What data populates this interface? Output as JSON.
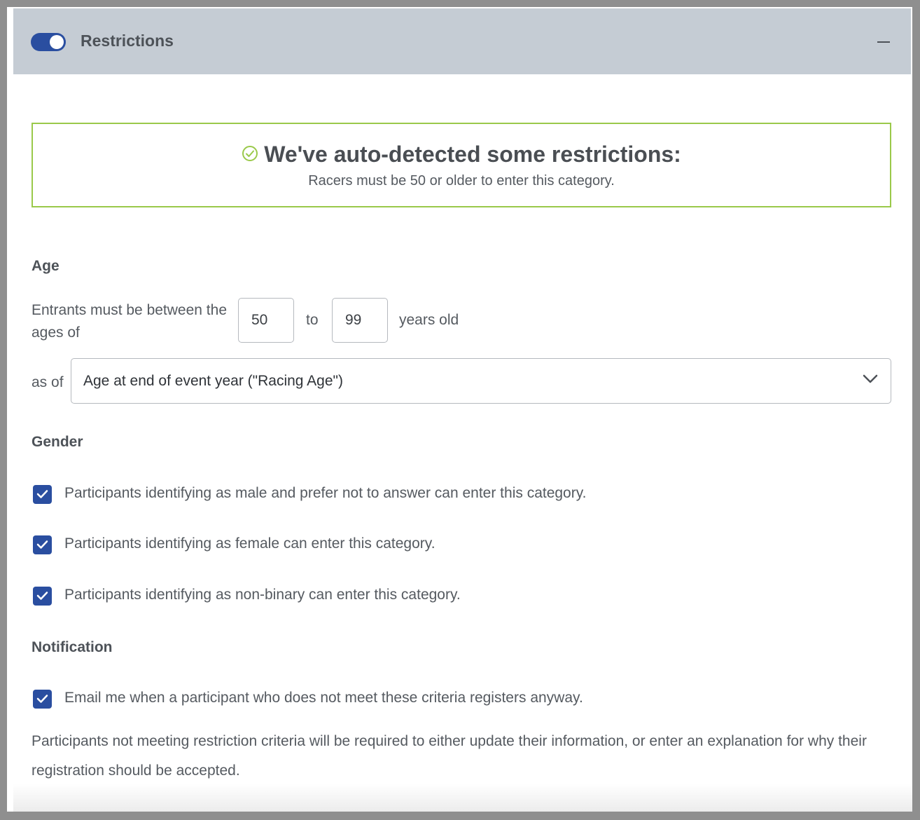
{
  "header": {
    "title": "Restrictions",
    "toggle_on": true,
    "toggle_color": "#2a4ea0",
    "background": "#c5ccd4"
  },
  "banner": {
    "icon": "check-circle-icon",
    "title": "We've auto-detected some restrictions:",
    "subtitle": "Racers must be 50 or older to enter this category.",
    "border_color": "#9ac94a"
  },
  "age": {
    "label": "Age",
    "description": "Entrants must be between the ages of",
    "min": "50",
    "to_label": "to",
    "max": "99",
    "suffix": "years old",
    "as_of_label": "as of",
    "as_of_value": "Age at end of event year (\"Racing Age\")"
  },
  "gender": {
    "label": "Gender",
    "options": [
      {
        "label": "Participants identifying as male and prefer not to answer can enter this category.",
        "checked": true
      },
      {
        "label": "Participants identifying as female can enter this category.",
        "checked": true
      },
      {
        "label": "Participants identifying as non-binary can enter this category.",
        "checked": true
      }
    ]
  },
  "notification": {
    "label": "Notification",
    "email_option": {
      "label": "Email me when a participant who does not meet these criteria registers anyway.",
      "checked": true
    },
    "footnote": "Participants not meeting restriction criteria will be required to either update their information, or enter an explanation for why their registration should be accepted."
  }
}
